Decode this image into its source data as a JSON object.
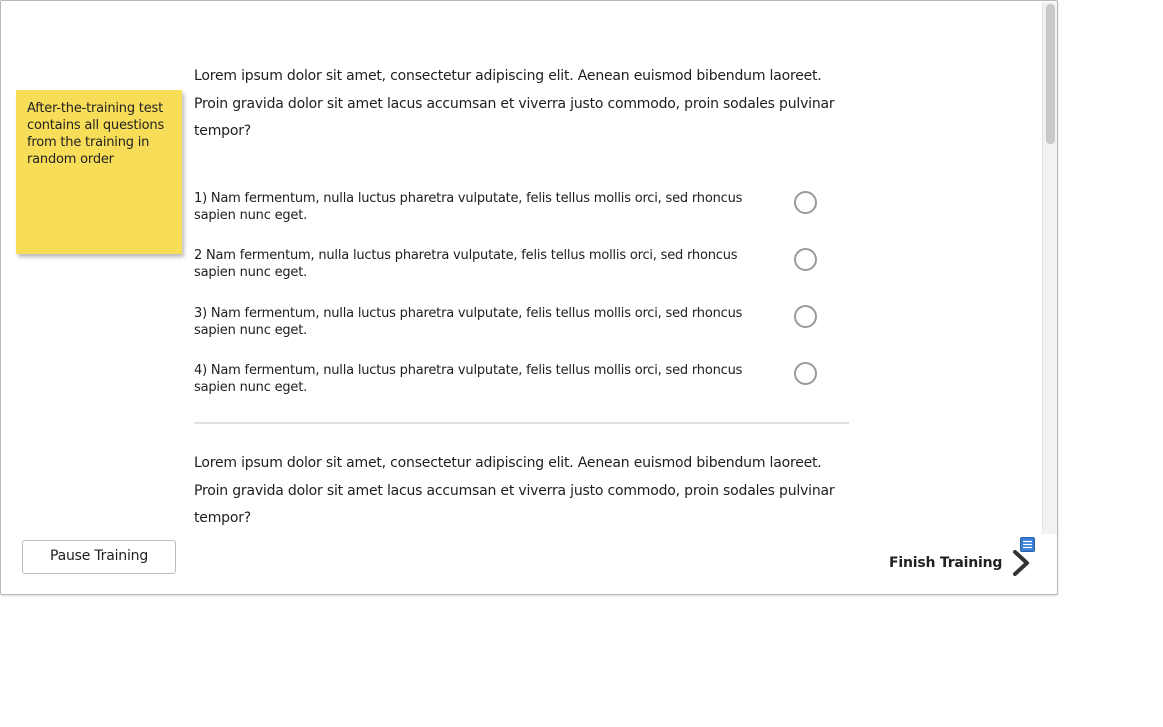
{
  "sticky_note": {
    "text": "After-the-training test contains all questions from the training in random order",
    "color": "#f8de58"
  },
  "question_1": {
    "text": "Lorem ipsum dolor sit amet, consectetur adipiscing elit. Aenean euismod bibendum laoreet. Proin gravida dolor sit amet lacus accumsan et viverra justo commodo, proin sodales pulvinar tempor?",
    "answers": [
      "1) Nam fermentum, nulla luctus pharetra vulputate, felis tellus mollis orci, sed rhoncus sapien nunc eget.",
      "2 Nam fermentum, nulla luctus pharetra vulputate, felis tellus mollis orci, sed rhoncus sapien nunc eget.",
      "3) Nam fermentum, nulla luctus pharetra vulputate, felis tellus mollis orci, sed rhoncus sapien nunc eget.",
      "4) Nam fermentum, nulla luctus pharetra vulputate, felis tellus mollis orci, sed rhoncus sapien nunc eget."
    ]
  },
  "question_2": {
    "text": "Lorem ipsum dolor sit amet, consectetur adipiscing elit. Aenean euismod bibendum laoreet. Proin gravida dolor sit amet lacus accumsan et viverra justo commodo, proin sodales pulvinar tempor?"
  },
  "footer": {
    "pause_label": "Pause Training",
    "finish_label": "Finish Training",
    "finish_icon": "chevron-right-icon",
    "note_icon": "note-icon",
    "note_icon_color": "#3a7fd5"
  }
}
